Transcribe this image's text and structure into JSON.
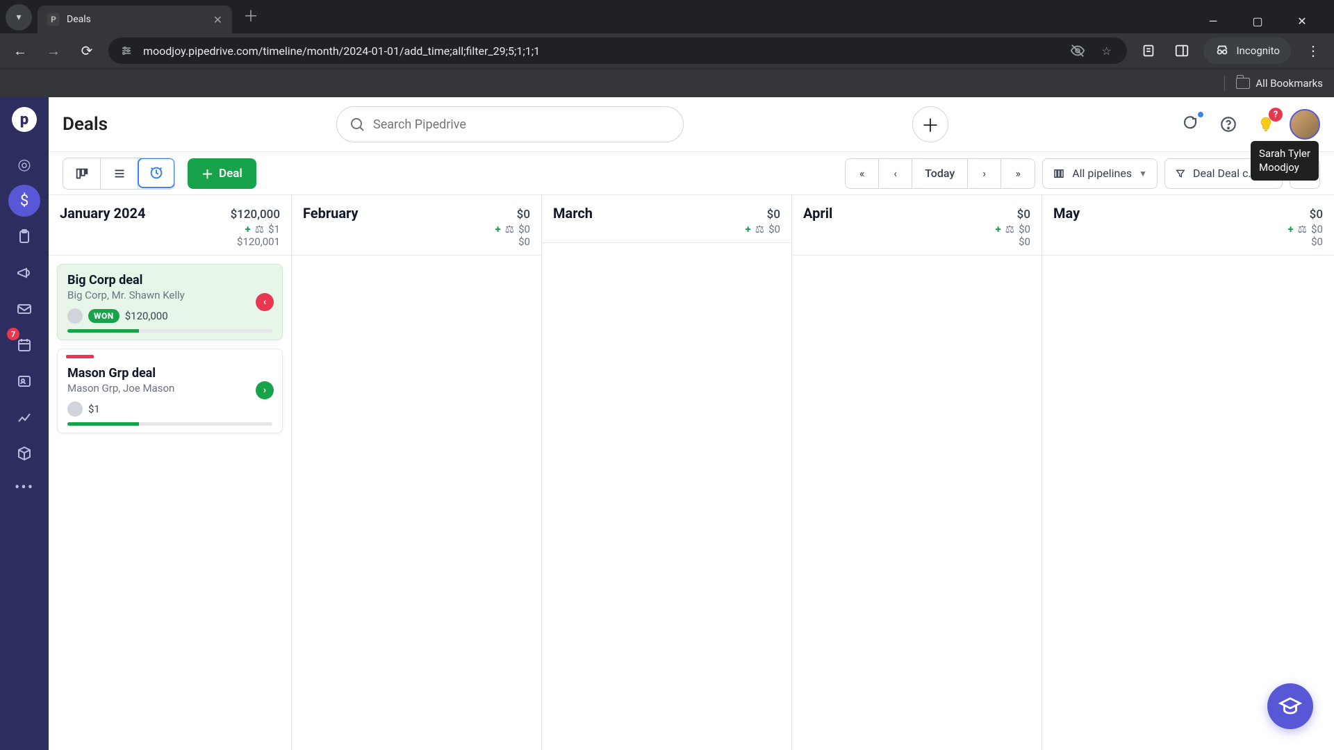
{
  "browser": {
    "tab_title": "Deals",
    "url": "moodjoy.pipedrive.com/timeline/month/2024-01-01/add_time;all;filter_29;5;1;1;1",
    "incognito_label": "Incognito",
    "all_bookmarks": "All Bookmarks"
  },
  "header": {
    "page_title": "Deals",
    "search_placeholder": "Search Pipedrive",
    "avatar_tooltip_name": "Sarah Tyler",
    "avatar_tooltip_org": "Moodjoy",
    "bulb_badge": "?"
  },
  "sidebar": {
    "inbox_badge": "7"
  },
  "toolbar": {
    "deal_label": "Deal",
    "today_label": "Today",
    "pipeline_label": "All pipelines",
    "filter_label": "Deal Deal c..."
  },
  "months": [
    {
      "name": "January 2024",
      "total": "$120,000",
      "weighted": "$1",
      "sum": "$120,001"
    },
    {
      "name": "February",
      "total": "$0",
      "weighted": "$0",
      "sum": "$0"
    },
    {
      "name": "March",
      "total": "$0",
      "weighted": "$0",
      "sum": ""
    },
    {
      "name": "April",
      "total": "$0",
      "weighted": "$0",
      "sum": "$0"
    },
    {
      "name": "May",
      "total": "$0",
      "weighted": "$0",
      "sum": "$0"
    }
  ],
  "deals": [
    {
      "title": "Big Corp deal",
      "subtitle": "Big Corp, Mr. Shawn Kelly",
      "status": "WON",
      "amount": "$120,000",
      "won": true,
      "arrow": "red",
      "progress": 35
    },
    {
      "title": "Mason Grp deal",
      "subtitle": "Mason Grp, Joe Mason",
      "status": "",
      "amount": "$1",
      "won": false,
      "arrow": "green",
      "stripe": "red",
      "progress": 35
    }
  ]
}
